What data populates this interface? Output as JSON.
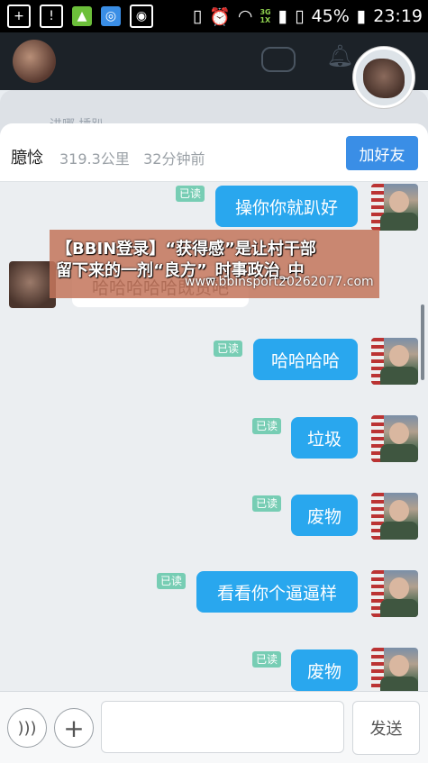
{
  "status_bar": {
    "time": "23:19",
    "battery": "45%",
    "network_top": "3G",
    "network_bottom": "1X"
  },
  "chat_header": {
    "name": "臆惗",
    "distance": "319.3公里",
    "time_ago": "32分钟前",
    "add_friend_label": "加好友"
  },
  "behind_panel_text": "进哪 捶趴",
  "messages": [
    {
      "side": "out",
      "text": "操你你就趴好",
      "read_label": "已读"
    },
    {
      "side": "in",
      "text": "哈哈哈哈哈既货吧"
    },
    {
      "side": "out",
      "text": "哈哈哈哈",
      "read_label": "已读"
    },
    {
      "side": "out",
      "text": "垃圾",
      "read_label": "已读"
    },
    {
      "side": "out",
      "text": "废物",
      "read_label": "已读"
    },
    {
      "side": "out",
      "text": "看看你个逼逼样",
      "read_label": "已读"
    },
    {
      "side": "out",
      "text": "废物",
      "read_label": "已读"
    }
  ],
  "ad_overlay": {
    "line1": "【BBIN登录】“获得感”是让村干部",
    "line2": "留下来的一剂“良方”_时事政治_中",
    "url": "www.bbinsport20262077.com"
  },
  "input_bar": {
    "placeholder": "",
    "send_label": "发送"
  },
  "colors": {
    "bubble_out": "#29a7ee",
    "add_friend": "#3a8ee6",
    "read_tag": "#77cdb4"
  }
}
